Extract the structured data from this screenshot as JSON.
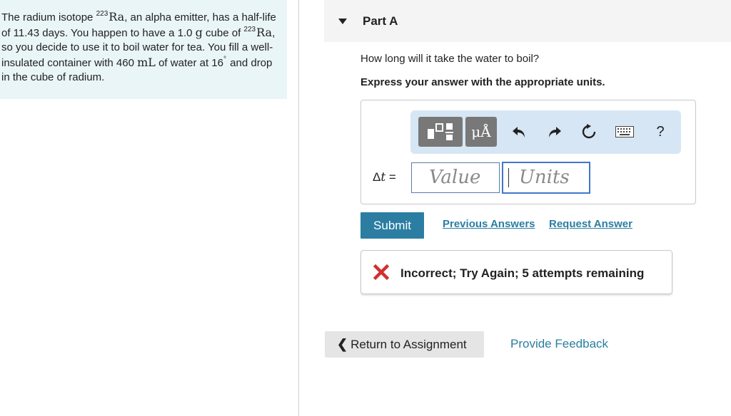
{
  "problem": {
    "text_1": "The radium isotope ",
    "isotope_mass": "223",
    "isotope_symbol": "Ra",
    "text_2": ", an alpha emitter, has a half-life of 11.43 days. You happen to have a 1.0 ",
    "unit_g": "g",
    "text_3": " cube of ",
    "text_4": ", so you decide to use it to boil water for tea. You fill a well-insulated container with 460 ",
    "unit_ml": "mL",
    "text_5": " of water at 16",
    "degree": "°",
    "text_6": " and drop in the cube of radium."
  },
  "part": {
    "title": "Part A",
    "question": "How long will it take the water to boil?",
    "instruction": "Express your answer with the appropriate units."
  },
  "toolbar": {
    "units_label": "μÅ",
    "help_label": "?"
  },
  "answer": {
    "variable": "t",
    "delta": "Δ",
    "equals": " =",
    "value_placeholder": "Value",
    "units_placeholder": "Units"
  },
  "actions": {
    "submit": "Submit",
    "previous_answers": "Previous Answers",
    "request_answer": "Request Answer"
  },
  "feedback": {
    "message": "Incorrect; Try Again; 5 attempts remaining"
  },
  "footer": {
    "return_label": "Return to Assignment",
    "return_chevron": "❮",
    "provide_feedback": "Provide Feedback"
  },
  "colors": {
    "accent": "#2b7ea1",
    "error": "#d32f2f"
  }
}
